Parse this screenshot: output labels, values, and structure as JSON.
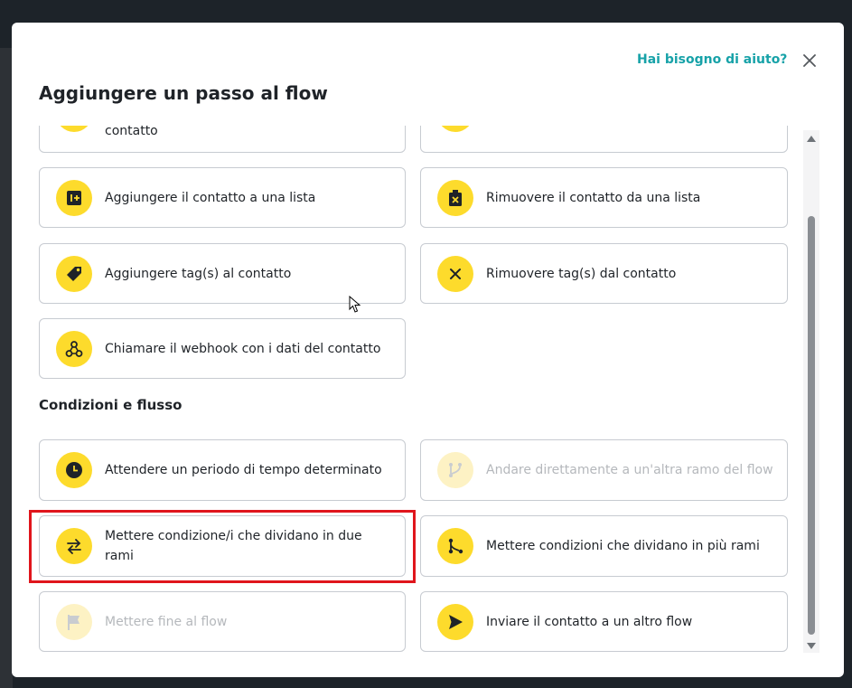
{
  "modal": {
    "help_link": "Hai bisogno di aiuto?",
    "title": "Aggiungere un passo al flow",
    "close_icon": "close-icon"
  },
  "actions": {
    "partial_left_label": "contatto",
    "add_list_label": "Aggiungere il contatto a una lista",
    "remove_list_label": "Rimuovere il contatto da una lista",
    "add_tag_label": "Aggiungere tag(s) al contatto",
    "remove_tag_label": "Rimuovere tag(s) dal contatto",
    "webhook_label": "Chiamare il webhook con i dati del contatto"
  },
  "conditions": {
    "section_title": "Condizioni e flusso",
    "wait_label": "Attendere un periodo di tempo determinato",
    "goto_branch_label": "Andare direttamente a un'altra ramo del flow",
    "split_two_label": "Mettere condizione/i che dividano in due rami",
    "split_many_label": "Mettere condizioni che dividano in più rami",
    "end_flow_label": "Mettere fine al flow",
    "send_flow_label": "Inviare il contatto a un altro flow"
  },
  "state": {
    "disabled_items": [
      "goto_branch",
      "end_flow"
    ],
    "highlighted_item": "split_two"
  },
  "colors": {
    "accent_yellow": "#fddb2c",
    "link_teal": "#17a2a8",
    "highlight_red": "#e0151c"
  }
}
